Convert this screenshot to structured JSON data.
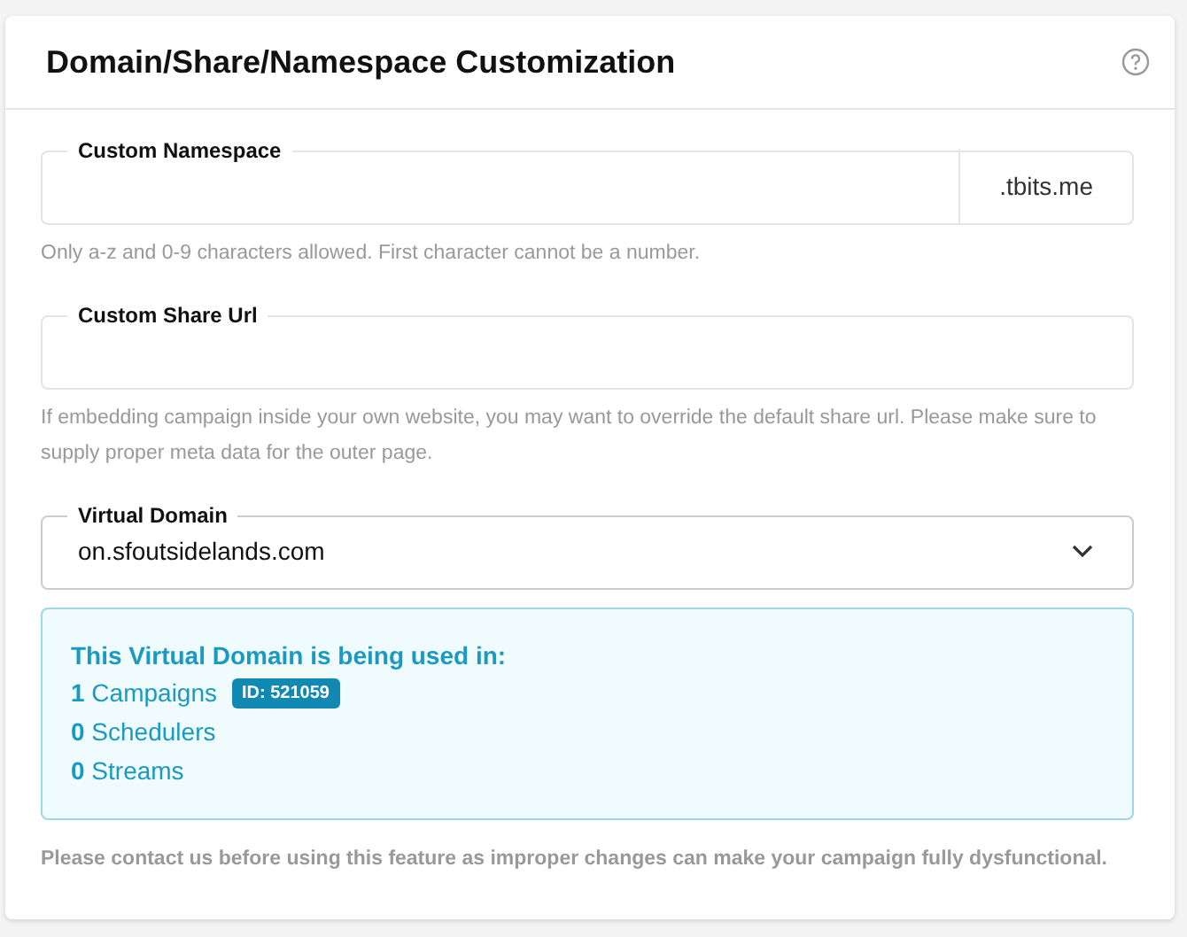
{
  "panel": {
    "title": "Domain/Share/Namespace Customization"
  },
  "namespace": {
    "label": "Custom Namespace",
    "suffix": ".tbits.me",
    "hint": "Only a-z and 0-9 characters allowed. First character cannot be a number."
  },
  "share_url": {
    "label": "Custom Share Url",
    "hint": "If embedding campaign inside your own website, you may want to override the default share url. Please make sure to supply proper meta data for the outer page."
  },
  "virtual_domain": {
    "label": "Virtual Domain",
    "value": "on.sfoutsidelands.com"
  },
  "usage": {
    "heading": "This Virtual Domain is being used in:",
    "items": [
      {
        "count": "1",
        "label": "Campaigns",
        "badge": "ID: 521059"
      },
      {
        "count": "0",
        "label": "Schedulers"
      },
      {
        "count": "0",
        "label": "Streams"
      }
    ]
  },
  "warning": "Please contact us before using this feature as improper changes can make your campaign fully dysfunctional."
}
